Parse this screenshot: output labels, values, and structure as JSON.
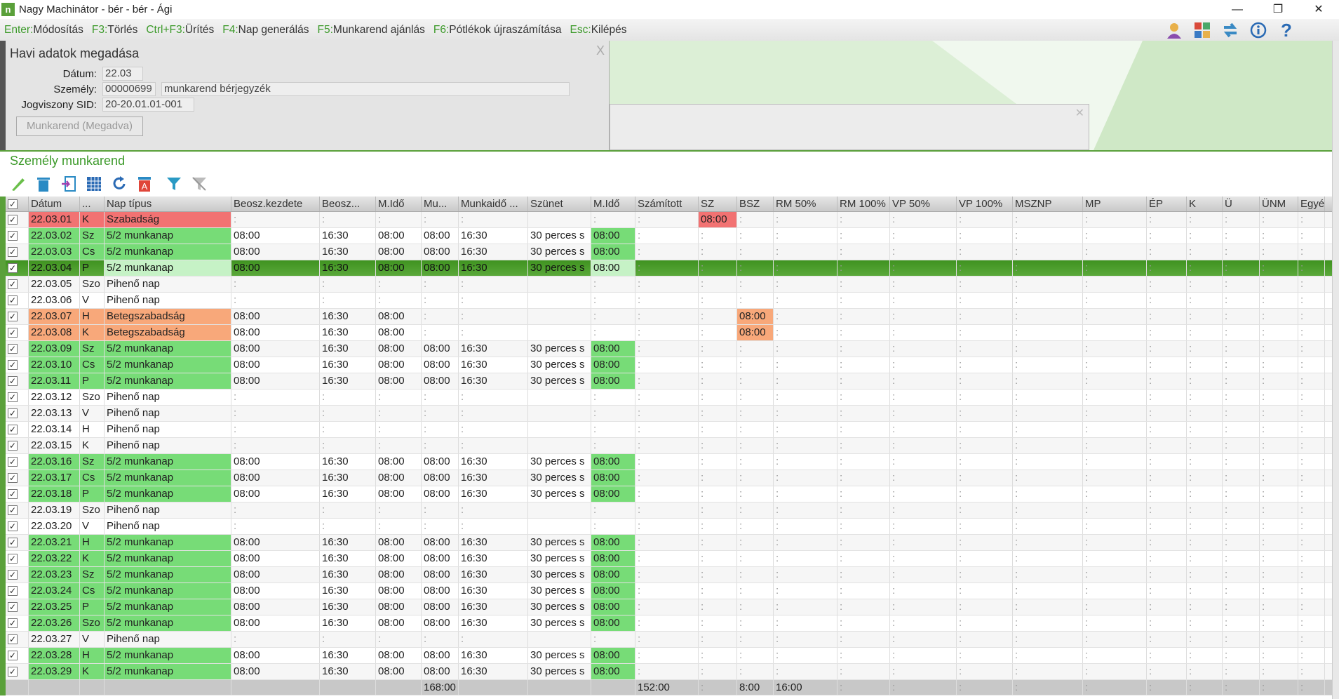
{
  "window": {
    "title": "Nagy Machinátor - bér - bér - Ági",
    "logo": "n",
    "min": "—",
    "max": "❐",
    "close": "✕"
  },
  "menu": [
    {
      "key": "Enter:",
      "label": "Módosítás"
    },
    {
      "key": "F3:",
      "label": "Törlés"
    },
    {
      "key": "Ctrl+F3:",
      "label": "Ürítés"
    },
    {
      "key": "F4:",
      "label": "Nap generálás"
    },
    {
      "key": "F5:",
      "label": "Munkarend ajánlás"
    },
    {
      "key": "F6:",
      "label": "Pótlékok újraszámítása"
    },
    {
      "key": "Esc:",
      "label": "Kilépés"
    }
  ],
  "panel": {
    "title": "Havi adatok megadása",
    "close": "X",
    "datum_label": "Dátum:",
    "datum": "22.03",
    "szemely_label": "Személy:",
    "szemely_id": "00000699",
    "szemely_name": "munkarend bérjegyzék",
    "sid_label": "Jogviszony SID:",
    "sid": "20-20.01.01-001",
    "button": "Munkarend (Megadva)",
    "inner_close": "✕"
  },
  "section": {
    "title": "Személy munkarend"
  },
  "columns": [
    "Dátum",
    "...",
    "Nap típus",
    "Beosz.kezdete",
    "Beosz...",
    "M.Idő",
    "Mu...",
    "Munkaidő ...",
    "Szünet",
    "M.Idő",
    "Számított",
    "SZ",
    "BSZ",
    "RM 50%",
    "RM 100%",
    "VP 50%",
    "VP 100%",
    "MSZNP",
    "MP",
    "ÉP",
    "K",
    "Ü",
    "ÜNM",
    "Egyéb"
  ],
  "rows": [
    {
      "d": "22.03.01",
      "n": "K",
      "t": "Szabadság",
      "k": "szab",
      "c": [
        "",
        "",
        "",
        "",
        "",
        "",
        "",
        "",
        "08:00",
        ""
      ]
    },
    {
      "d": "22.03.02",
      "n": "Sz",
      "t": "5/2 munkanap",
      "k": "work",
      "c": [
        "08:00",
        "16:30",
        "08:00",
        "08:00",
        "16:30",
        "30 perces s",
        "08:00",
        "",
        "",
        ""
      ]
    },
    {
      "d": "22.03.03",
      "n": "Cs",
      "t": "5/2 munkanap",
      "k": "work",
      "c": [
        "08:00",
        "16:30",
        "08:00",
        "08:00",
        "16:30",
        "30 perces s",
        "08:00",
        "",
        "",
        ""
      ]
    },
    {
      "d": "22.03.04",
      "n": "P",
      "t": "5/2 munkanap",
      "k": "work",
      "selected": true,
      "c": [
        "08:00",
        "16:30",
        "08:00",
        "08:00",
        "16:30",
        "30 perces s",
        "08:00",
        "",
        "",
        ""
      ]
    },
    {
      "d": "22.03.05",
      "n": "Szo",
      "t": "Pihenő nap",
      "k": "rest",
      "c": [
        "",
        "",
        "",
        "",
        "",
        "",
        "",
        "",
        "",
        ""
      ]
    },
    {
      "d": "22.03.06",
      "n": "V",
      "t": "Pihenő nap",
      "k": "rest",
      "c": [
        "",
        "",
        "",
        "",
        "",
        "",
        "",
        "",
        "",
        ""
      ]
    },
    {
      "d": "22.03.07",
      "n": "H",
      "t": "Betegszabadság",
      "k": "beteg",
      "c": [
        "08:00",
        "16:30",
        "08:00",
        "",
        "",
        "",
        "",
        "",
        "",
        "08:00"
      ]
    },
    {
      "d": "22.03.08",
      "n": "K",
      "t": "Betegszabadság",
      "k": "beteg",
      "c": [
        "08:00",
        "16:30",
        "08:00",
        "",
        "",
        "",
        "",
        "",
        "",
        "08:00"
      ]
    },
    {
      "d": "22.03.09",
      "n": "Sz",
      "t": "5/2 munkanap",
      "k": "work",
      "c": [
        "08:00",
        "16:30",
        "08:00",
        "08:00",
        "16:30",
        "30 perces s",
        "08:00",
        "",
        "",
        ""
      ]
    },
    {
      "d": "22.03.10",
      "n": "Cs",
      "t": "5/2 munkanap",
      "k": "work",
      "c": [
        "08:00",
        "16:30",
        "08:00",
        "08:00",
        "16:30",
        "30 perces s",
        "08:00",
        "",
        "",
        ""
      ]
    },
    {
      "d": "22.03.11",
      "n": "P",
      "t": "5/2 munkanap",
      "k": "work",
      "c": [
        "08:00",
        "16:30",
        "08:00",
        "08:00",
        "16:30",
        "30 perces s",
        "08:00",
        "",
        "",
        ""
      ]
    },
    {
      "d": "22.03.12",
      "n": "Szo",
      "t": "Pihenő nap",
      "k": "rest",
      "c": [
        "",
        "",
        "",
        "",
        "",
        "",
        "",
        "",
        "",
        ""
      ]
    },
    {
      "d": "22.03.13",
      "n": "V",
      "t": "Pihenő nap",
      "k": "rest",
      "c": [
        "",
        "",
        "",
        "",
        "",
        "",
        "",
        "",
        "",
        ""
      ]
    },
    {
      "d": "22.03.14",
      "n": "H",
      "t": "Pihenő nap",
      "k": "rest",
      "c": [
        "",
        "",
        "",
        "",
        "",
        "",
        "",
        "",
        "",
        ""
      ]
    },
    {
      "d": "22.03.15",
      "n": "K",
      "t": "Pihenő nap",
      "k": "rest",
      "c": [
        "",
        "",
        "",
        "",
        "",
        "",
        "",
        "",
        "",
        ""
      ]
    },
    {
      "d": "22.03.16",
      "n": "Sz",
      "t": "5/2 munkanap",
      "k": "work",
      "c": [
        "08:00",
        "16:30",
        "08:00",
        "08:00",
        "16:30",
        "30 perces s",
        "08:00",
        "",
        "",
        ""
      ]
    },
    {
      "d": "22.03.17",
      "n": "Cs",
      "t": "5/2 munkanap",
      "k": "work",
      "c": [
        "08:00",
        "16:30",
        "08:00",
        "08:00",
        "16:30",
        "30 perces s",
        "08:00",
        "",
        "",
        ""
      ]
    },
    {
      "d": "22.03.18",
      "n": "P",
      "t": "5/2 munkanap",
      "k": "work",
      "c": [
        "08:00",
        "16:30",
        "08:00",
        "08:00",
        "16:30",
        "30 perces s",
        "08:00",
        "",
        "",
        ""
      ]
    },
    {
      "d": "22.03.19",
      "n": "Szo",
      "t": "Pihenő nap",
      "k": "rest",
      "c": [
        "",
        "",
        "",
        "",
        "",
        "",
        "",
        "",
        "",
        ""
      ]
    },
    {
      "d": "22.03.20",
      "n": "V",
      "t": "Pihenő nap",
      "k": "rest",
      "c": [
        "",
        "",
        "",
        "",
        "",
        "",
        "",
        "",
        "",
        ""
      ]
    },
    {
      "d": "22.03.21",
      "n": "H",
      "t": "5/2 munkanap",
      "k": "work",
      "c": [
        "08:00",
        "16:30",
        "08:00",
        "08:00",
        "16:30",
        "30 perces s",
        "08:00",
        "",
        "",
        ""
      ]
    },
    {
      "d": "22.03.22",
      "n": "K",
      "t": "5/2 munkanap",
      "k": "work",
      "c": [
        "08:00",
        "16:30",
        "08:00",
        "08:00",
        "16:30",
        "30 perces s",
        "08:00",
        "",
        "",
        ""
      ]
    },
    {
      "d": "22.03.23",
      "n": "Sz",
      "t": "5/2 munkanap",
      "k": "work",
      "c": [
        "08:00",
        "16:30",
        "08:00",
        "08:00",
        "16:30",
        "30 perces s",
        "08:00",
        "",
        "",
        ""
      ]
    },
    {
      "d": "22.03.24",
      "n": "Cs",
      "t": "5/2 munkanap",
      "k": "work",
      "c": [
        "08:00",
        "16:30",
        "08:00",
        "08:00",
        "16:30",
        "30 perces s",
        "08:00",
        "",
        "",
        ""
      ]
    },
    {
      "d": "22.03.25",
      "n": "P",
      "t": "5/2 munkanap",
      "k": "work",
      "c": [
        "08:00",
        "16:30",
        "08:00",
        "08:00",
        "16:30",
        "30 perces s",
        "08:00",
        "",
        "",
        ""
      ]
    },
    {
      "d": "22.03.26",
      "n": "Szo",
      "t": "5/2 munkanap",
      "k": "work",
      "c": [
        "08:00",
        "16:30",
        "08:00",
        "08:00",
        "16:30",
        "30 perces s",
        "08:00",
        "",
        "",
        ""
      ]
    },
    {
      "d": "22.03.27",
      "n": "V",
      "t": "Pihenő nap",
      "k": "rest",
      "c": [
        "",
        "",
        "",
        "",
        "",
        "",
        "",
        "",
        "",
        ""
      ]
    },
    {
      "d": "22.03.28",
      "n": "H",
      "t": "5/2 munkanap",
      "k": "work",
      "c": [
        "08:00",
        "16:30",
        "08:00",
        "08:00",
        "16:30",
        "30 perces s",
        "08:00",
        "",
        "",
        ""
      ]
    },
    {
      "d": "22.03.29",
      "n": "K",
      "t": "5/2 munkanap",
      "k": "work",
      "c": [
        "08:00",
        "16:30",
        "08:00",
        "08:00",
        "16:30",
        "30 perces s",
        "08:00",
        "",
        "",
        ""
      ]
    }
  ],
  "totals": {
    "mido": "168:00",
    "mido2": "152:00",
    "sz": "8:00",
    "bsz": "16:00"
  },
  "colors": {
    "work": "#77dc77",
    "szab": "#f27272",
    "beteg": "#f8a87a",
    "accent": "#5aa03a"
  }
}
